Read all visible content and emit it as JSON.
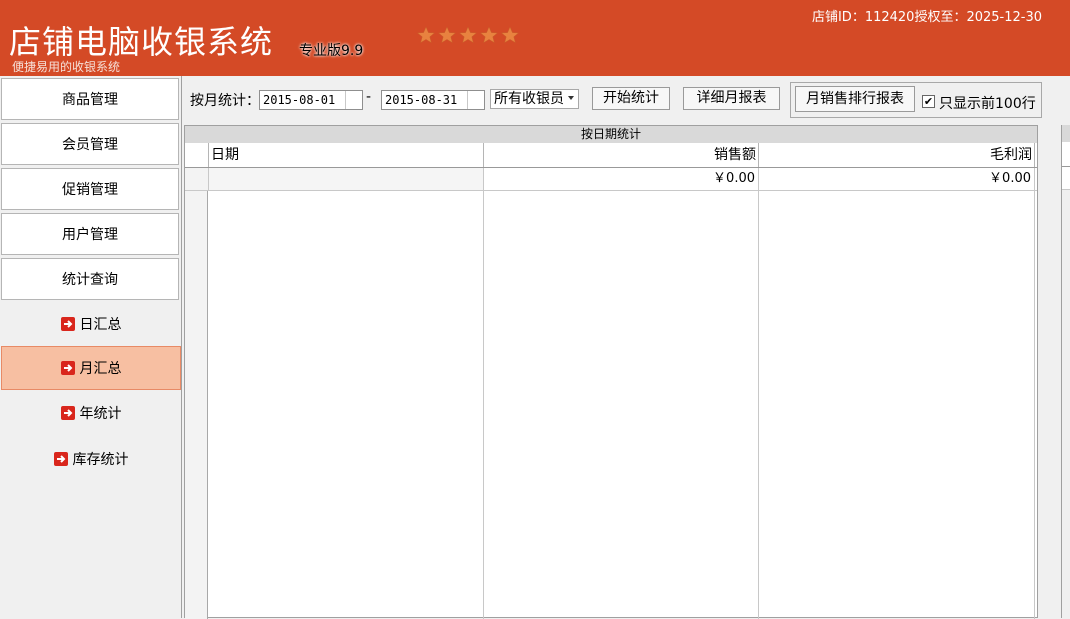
{
  "header": {
    "app_title": "店铺电脑收银系统",
    "edition": "专业版9.9",
    "subtitle": "便捷易用的收银系统",
    "license_text": "店铺ID：112420授权至：2025-12-30",
    "rating_stars": 5,
    "accent_color": "#d44a26"
  },
  "sidebar": {
    "menu_items": [
      {
        "label": "商品管理"
      },
      {
        "label": "会员管理"
      },
      {
        "label": "促销管理"
      },
      {
        "label": "用户管理"
      },
      {
        "label": "统计查询"
      }
    ],
    "sub_items": [
      {
        "label": "日汇总",
        "icon": "arrow-right-icon",
        "active": false
      },
      {
        "label": "月汇总",
        "icon": "arrow-right-icon",
        "active": true
      },
      {
        "label": "年统计",
        "icon": "arrow-right-icon",
        "active": false
      },
      {
        "label": "库存统计",
        "icon": "arrow-right-icon",
        "active": false
      }
    ],
    "active_color": "#f7bfa2"
  },
  "toolbar": {
    "label": "按月统计：",
    "start_date": "2015-08-01",
    "separator": "-",
    "end_date": "2015-08-31",
    "cashier_select": "所有收银员",
    "start_button": "开始统计",
    "detail_button": "详细月报表",
    "ranking_button": "月销售排行报表",
    "top100_checked": true,
    "top100_label": "只显示前100行"
  },
  "grid": {
    "caption": "按日期统计",
    "columns": [
      "日期",
      "销售额",
      "毛利润"
    ],
    "rows": [
      {
        "date": "",
        "sales": "￥0.00",
        "profit": "￥0.00"
      }
    ]
  }
}
